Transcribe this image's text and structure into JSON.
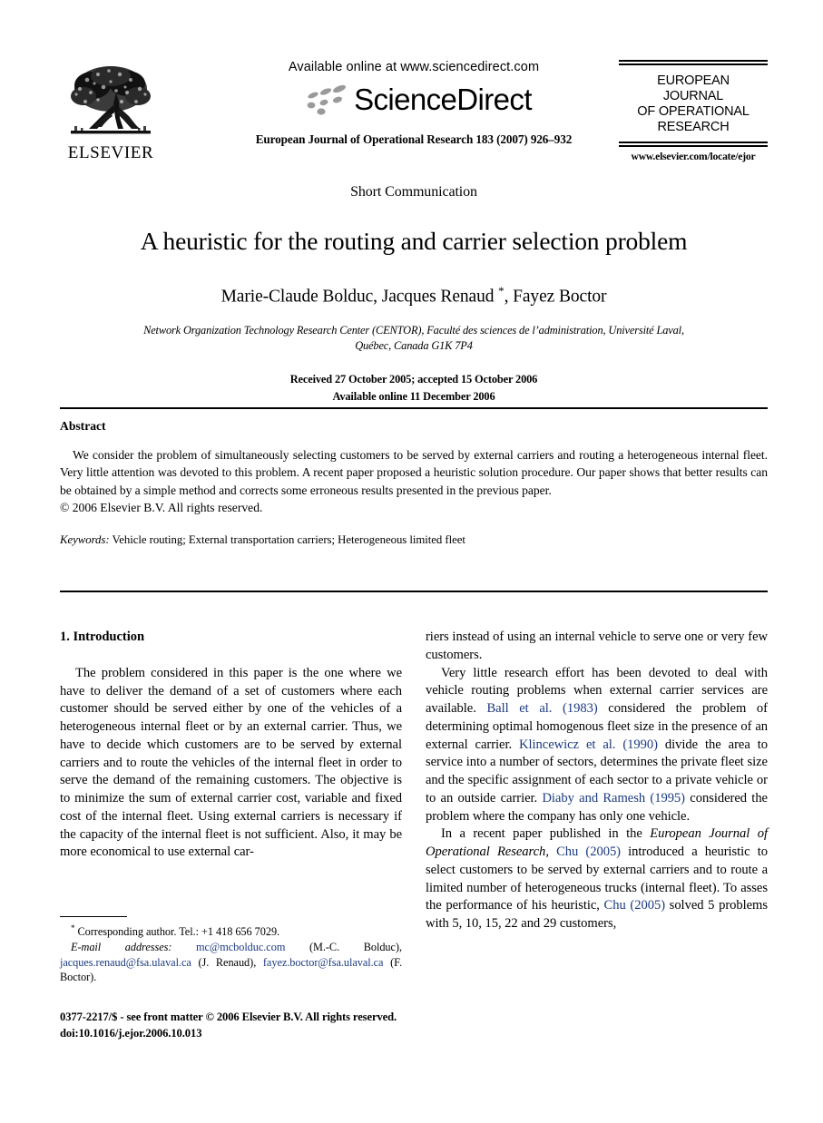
{
  "masthead": {
    "publisher_name": "ELSEVIER",
    "publisher_logo_icon": "elsevier-tree-logo",
    "available_online": "Available online at www.sciencedirect.com",
    "sciencedirect_wordmark": "ScienceDirect",
    "sciencedirect_logo_icon": "sciencedirect-swoosh-icon",
    "journal_reference": "European Journal of Operational Research 183 (2007) 926–932",
    "journal_box": {
      "line1": "EUROPEAN",
      "line2": "JOURNAL",
      "line3": "OF OPERATIONAL",
      "line4": "RESEARCH",
      "url": "www.elsevier.com/locate/ejor"
    }
  },
  "article": {
    "section_type": "Short Communication",
    "title": "A heuristic for the routing and carrier selection problem",
    "authors": "Marie-Claude Bolduc, Jacques Renaud ",
    "authors_corresponding_marker": "*",
    "authors_tail": ", Fayez Boctor",
    "affiliation_line1": "Network Organization Technology Research Center (CENTOR), Faculté des sciences de l’administration, Université Laval,",
    "affiliation_line2": "Québec, Canada G1K 7P4",
    "received_line": "Received 27 October 2005; accepted 15 October 2006",
    "available_line": "Available online 11 December 2006"
  },
  "abstract": {
    "heading": "Abstract",
    "text": "We consider the problem of simultaneously selecting customers to be served by external carriers and routing a heterogeneous internal fleet. Very little attention was devoted to this problem. A recent paper proposed a heuristic solution procedure. Our paper shows that better results can be obtained by a simple method and corrects some erroneous results presented in the previous paper.",
    "copyright": "© 2006 Elsevier B.V. All rights reserved.",
    "keywords_label": "Keywords:",
    "keywords_value": "Vehicle routing; External transportation carriers; Heterogeneous limited fleet"
  },
  "body": {
    "section_heading": "1. Introduction",
    "left_paragraph_1": "The problem considered in this paper is the one where we have to deliver the demand of a set of customers where each customer should be served either by one of the vehicles of a heterogeneous internal fleet or by an external carrier. Thus, we have to decide which customers are to be served by external carriers and to route the vehicles of the internal fleet in order to serve the demand of the remaining customers. The objective is to minimize the sum of external carrier cost, variable and fixed cost of the internal fleet. Using external carriers is necessary if the capacity of the internal fleet is not sufficient. Also, it may be more economical to use external car-",
    "right_paragraph_1_cont": "riers instead of using an internal vehicle to serve one or very few customers.",
    "right_paragraph_2_a": "Very little research effort has been devoted to deal with vehicle routing problems when external carrier services are available. ",
    "right_ref_ball": "Ball et al. (1983)",
    "right_paragraph_2_b": " considered the problem of determining optimal homogenous fleet size in the presence of an external carrier. ",
    "right_ref_klincewicz": "Klincewicz et al. (1990)",
    "right_paragraph_2_c": " divide the area to service into a number of sectors, determines the private fleet size and the specific assignment of each sector to a private vehicle or to an outside carrier. ",
    "right_ref_diaby": "Diaby and Ramesh (1995)",
    "right_paragraph_2_d": " considered the problem where the company has only one vehicle.",
    "right_paragraph_3_a": "In a recent paper published in the ",
    "right_journal_italic": "European Journal of Operational Research",
    "right_paragraph_3_b": ", ",
    "right_ref_chu1": "Chu (2005)",
    "right_paragraph_3_c": " introduced a heuristic to select customers to be served by external carriers and to route a limited number of heterogeneous trucks (internal fleet). To asses the performance of his heuristic, ",
    "right_ref_chu2": "Chu (2005)",
    "right_paragraph_3_d": " solved 5 problems with 5, 10, 15, 22 and 29 customers,"
  },
  "footnote": {
    "corresponding_marker": "*",
    "corresponding_text": " Corresponding author. Tel.: +1 418 656 7029.",
    "email_label": "E-mail addresses:",
    "email_1": "mc@mcbolduc.com",
    "email_1_owner": "(M.-C. Bolduc),",
    "email_2": "jacques.renaud@fsa.ulaval.ca",
    "email_2_owner": "(J. Renaud),",
    "email_3": "fayez.boctor@fsa.ulaval.ca",
    "email_3_owner": "(F. Boctor)."
  },
  "footer": {
    "front_matter": "0377-2217/$ - see front matter © 2006 Elsevier B.V. All rights reserved.",
    "doi": "doi:10.1016/j.ejor.2006.10.013"
  },
  "colors": {
    "link": "#1b3a80",
    "text": "#000000",
    "page_background": "#ffffff",
    "sciencedirect_swoosh": "#999999"
  }
}
